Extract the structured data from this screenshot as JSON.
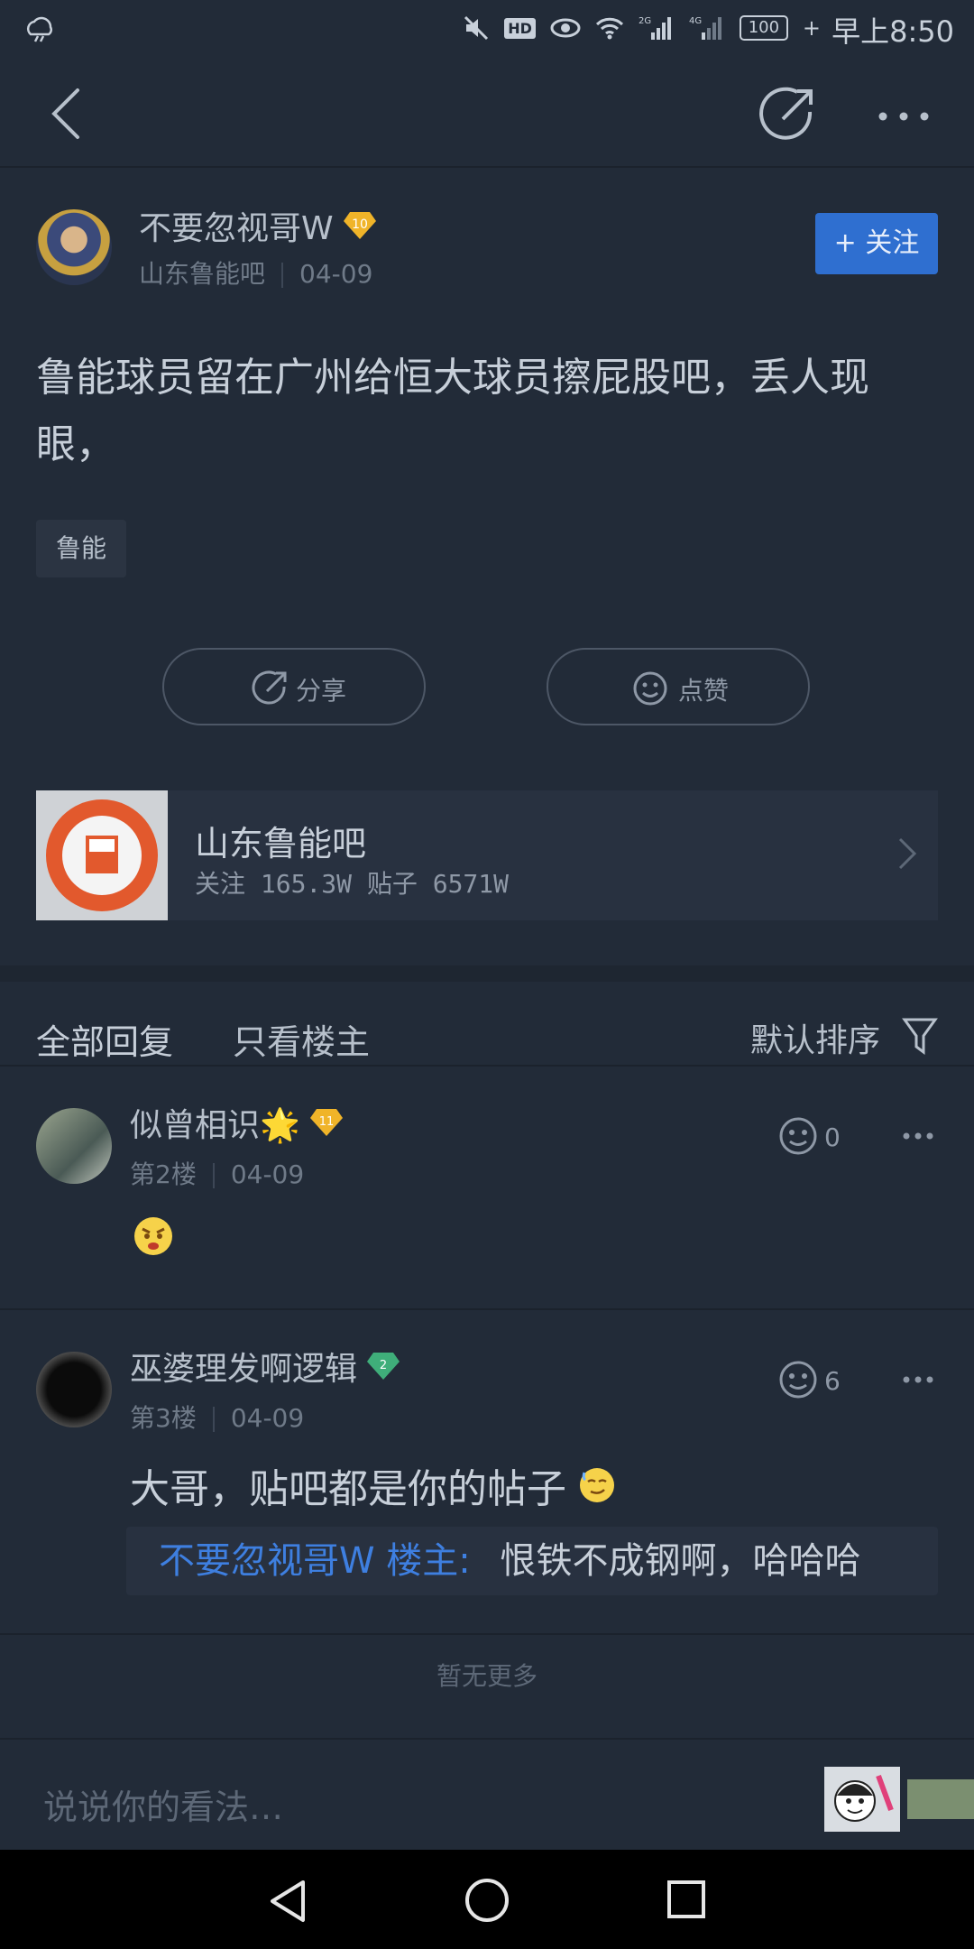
{
  "status_bar": {
    "time": "早上8:50",
    "battery": "100"
  },
  "post": {
    "author": "不要忽视哥W",
    "author_level": "10",
    "forum": "山东鲁能吧",
    "date": "04-09",
    "follow_label": "+ 关注",
    "content": "鲁能球员留在广州给恒大球员擦屁股吧，丢人现眼，",
    "tag": "鲁能",
    "share_label": "分享",
    "like_label": "点赞"
  },
  "forum_card": {
    "name": "山东鲁能吧",
    "stats": "关注 165.3W  贴子 6571W"
  },
  "tabs": {
    "all_replies": "全部回复",
    "op_only": "只看楼主",
    "sort": "默认排序"
  },
  "replies": [
    {
      "author": "似曾相识🌟",
      "level": "11",
      "floor": "第2楼",
      "date": "04-09",
      "likes": "0",
      "text": ""
    },
    {
      "author": "巫婆理发啊逻辑",
      "level": "2",
      "floor": "第3楼",
      "date": "04-09",
      "likes": "6",
      "text": "大哥，贴吧都是你的帖子",
      "quote_author": "不要忽视哥W 楼主:",
      "quote_text": "恨铁不成钢啊，哈哈哈"
    }
  ],
  "no_more": "暂无更多",
  "composer_placeholder": "说说你的看法…",
  "colors": {
    "accent": "#2f6fd0",
    "link": "#3e7fe0",
    "bg": "#222b38"
  }
}
